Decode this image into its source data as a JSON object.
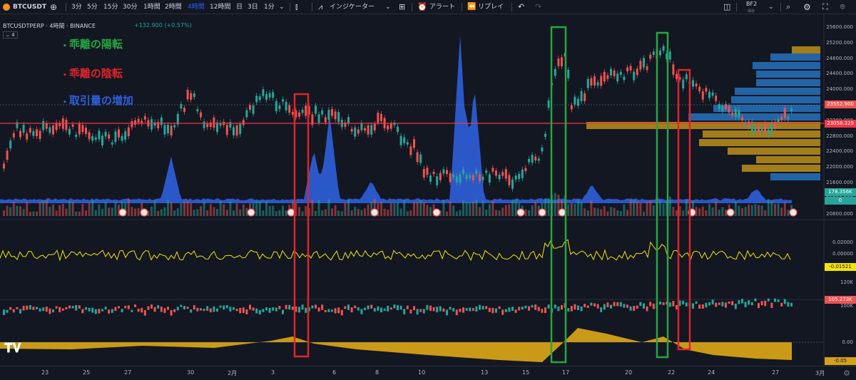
{
  "toolbar": {
    "symbol": "BTCUSDT",
    "intervals": [
      "3分",
      "5分",
      "15分",
      "30分",
      "1時間",
      "2時間",
      "4時間",
      "12時間",
      "日",
      "3日",
      "1分"
    ],
    "active_interval": "4時間",
    "indicators_label": "インジケーター",
    "alert_label": "アラート",
    "replay_label": "リプレイ",
    "layout_name": "BF2",
    "layout_sub": "保存"
  },
  "header": {
    "title": "BTCUSDTPERP · 4時間 · BINANCE",
    "change": "+132.900 (+0.57%)",
    "collapse_count": "4"
  },
  "legend": {
    "items": [
      {
        "label": "乖離の陽転",
        "color": "#26a641"
      },
      {
        "label": "乖離の陰転",
        "color": "#e0242a"
      },
      {
        "label": "取引量の増加",
        "color": "#2f5fdc"
      }
    ]
  },
  "price_axis": {
    "ticks": [
      "25600.000",
      "25200.000",
      "24800.000",
      "24400.000",
      "24000.000",
      "23600.000",
      "23200.000",
      "22800.000",
      "22400.000",
      "22000.000",
      "21600.000",
      "21200.000",
      "20800.000"
    ],
    "current_price": "23552.900",
    "red_line_price": "23058.329",
    "volume_tag": "178.356K",
    "zero_tag": "0"
  },
  "osc_axis": {
    "ticks": [
      "0.02000",
      "0.00000"
    ],
    "current": "-0.01521"
  },
  "vol2_axis": {
    "ticks": [
      "120K",
      "100K"
    ],
    "current": "105.273K"
  },
  "dev_axis": {
    "ticks": [
      "0.00",
      "-0.05"
    ]
  },
  "time_axis": {
    "ticks": [
      "23",
      "25",
      "27",
      "30",
      "2月",
      "3",
      "6",
      "8",
      "10",
      "13",
      "15",
      "17",
      "20",
      "22",
      "24",
      "27",
      "3月"
    ]
  },
  "colors": {
    "up": "#26a69a",
    "down": "#ef5350",
    "background": "#131722",
    "volume_profile_blue": "#2a7fd4",
    "volume_profile_gold": "#d4a017"
  }
}
